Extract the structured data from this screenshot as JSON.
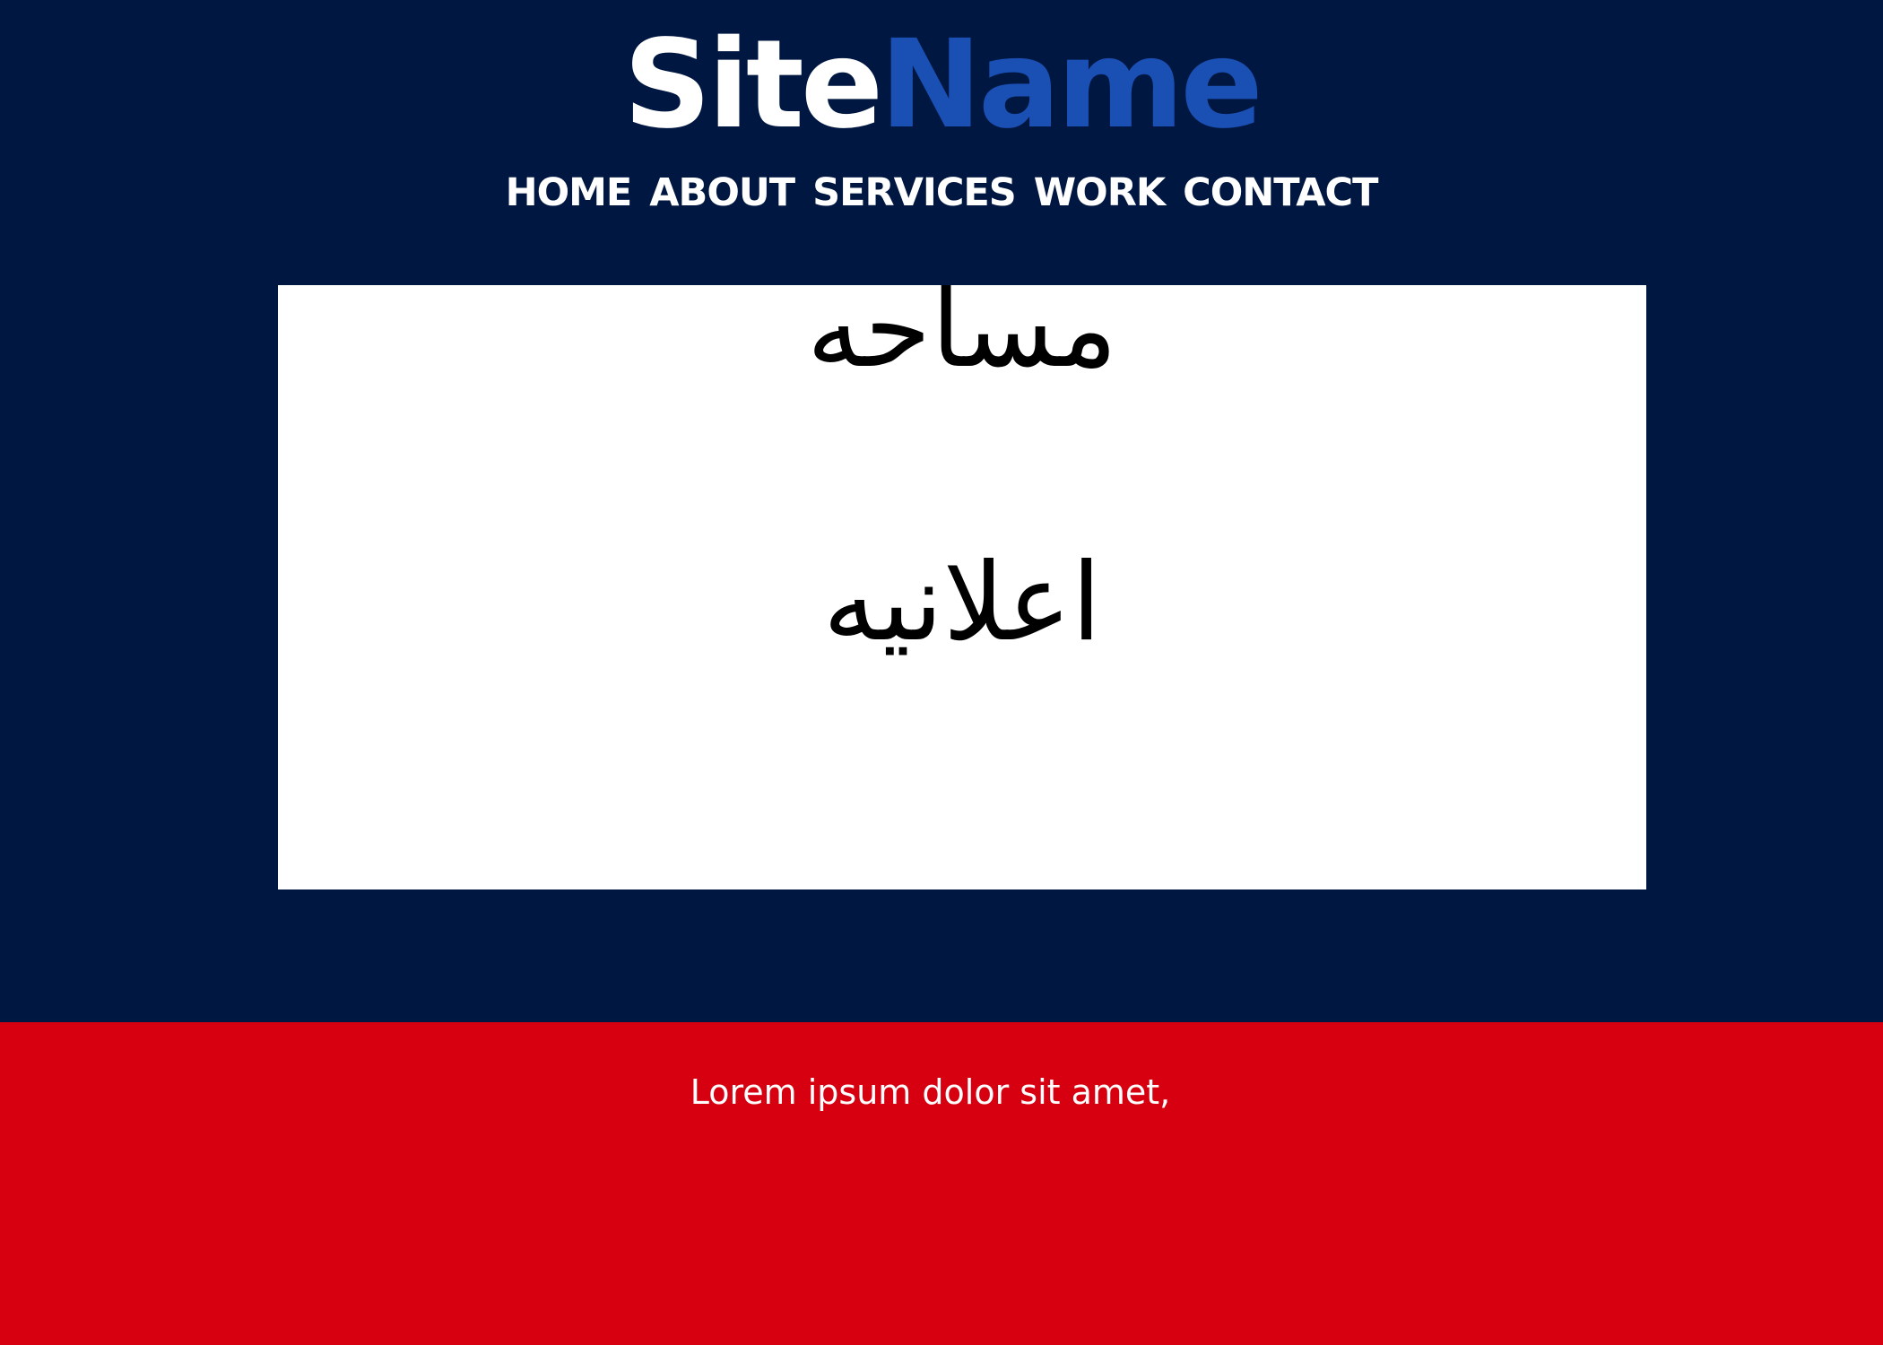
{
  "header": {
    "logo": {
      "part1": "Site",
      "part2": "Name"
    },
    "nav": {
      "items": [
        "HOME",
        "ABOUT",
        "SERVICES",
        "WORK",
        "CONTACT"
      ]
    }
  },
  "ad": {
    "line1": "مساحه",
    "line2": "اعلانيه"
  },
  "footer": {
    "text": "Lorem ipsum dolor sit amet,"
  },
  "colors": {
    "header_background": "#001742",
    "logo_accent": "#1a4fb3",
    "footer_background": "#d60010",
    "ad_background": "#ffffff"
  }
}
